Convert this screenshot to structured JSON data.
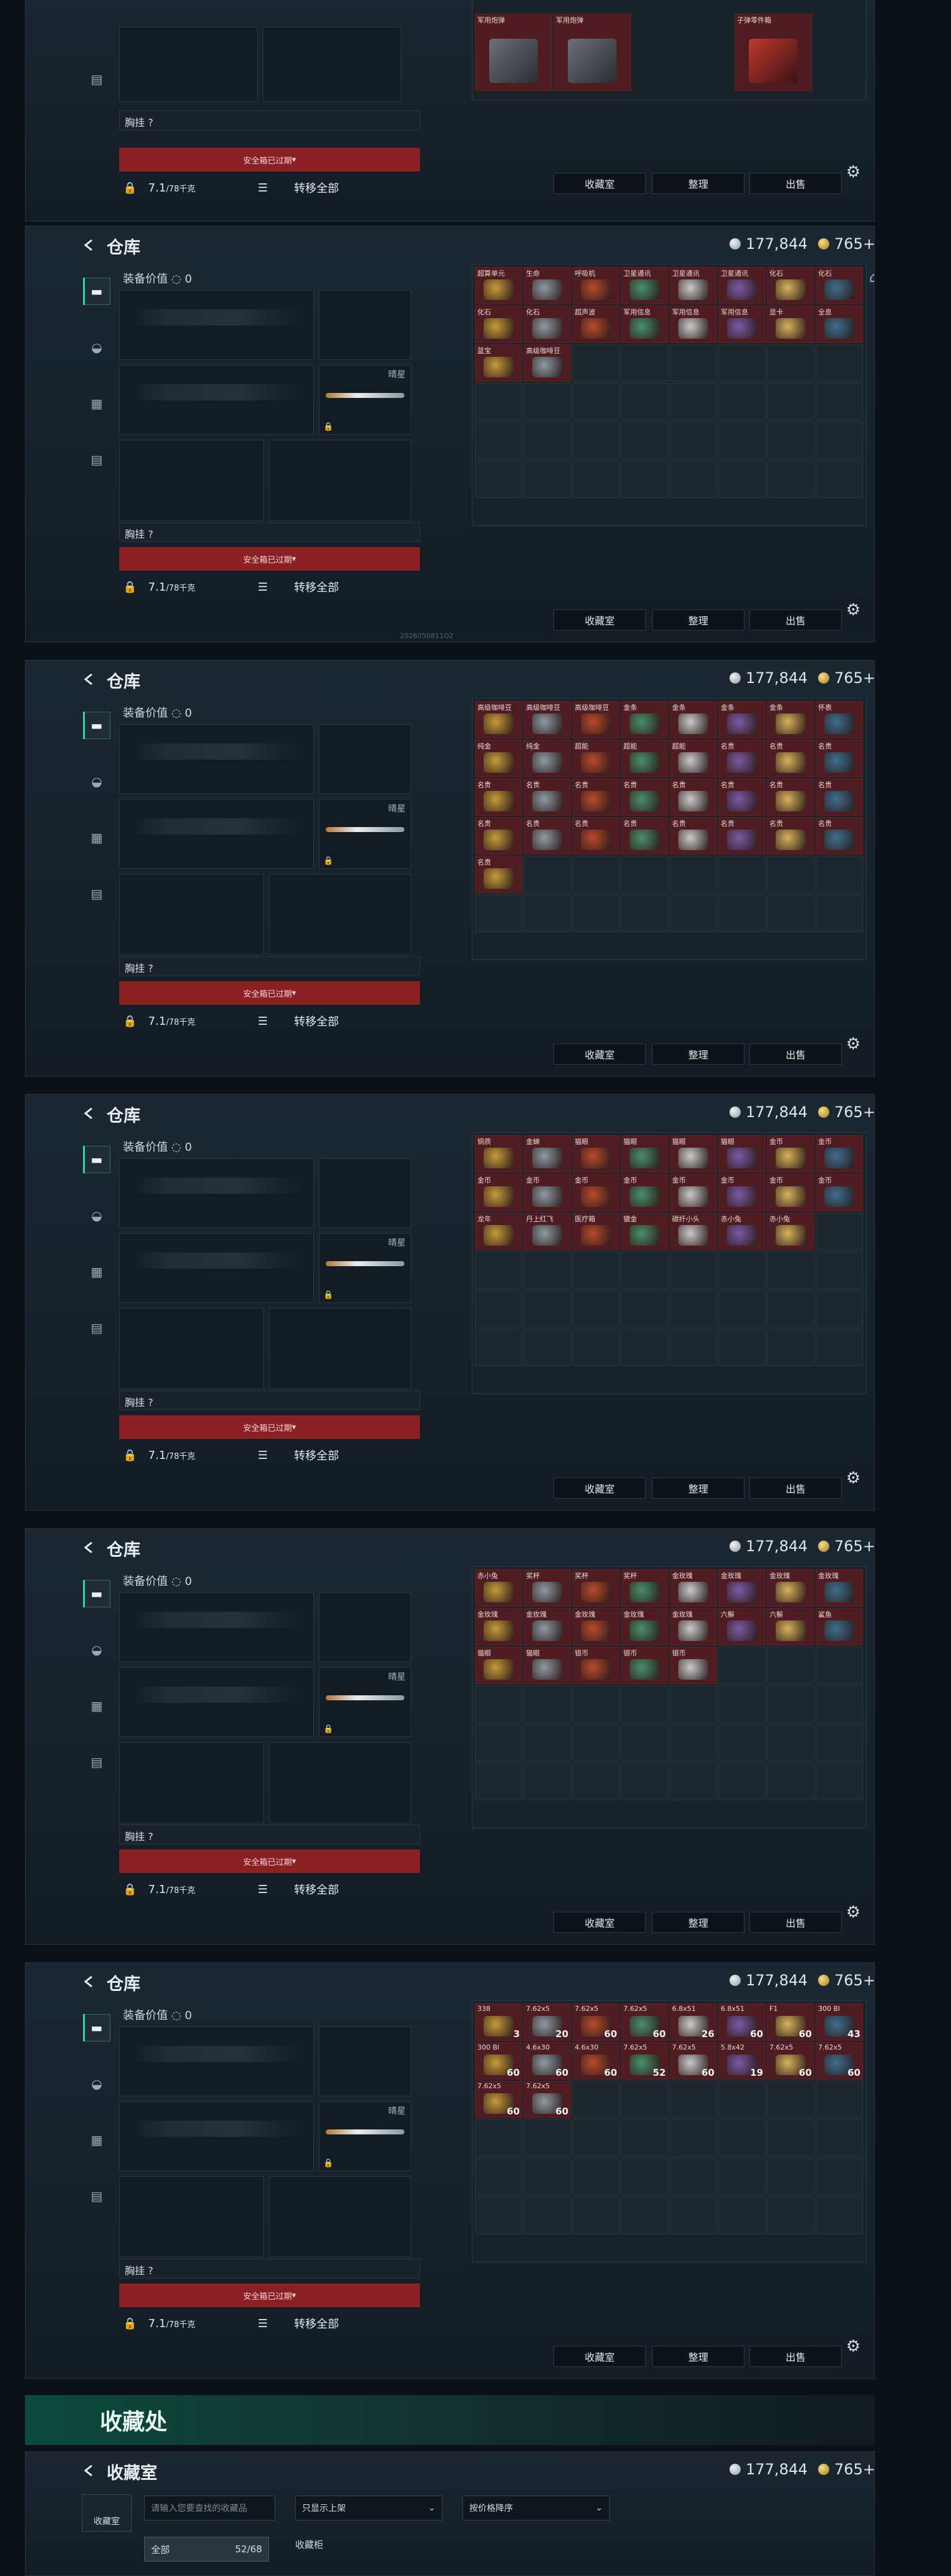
{
  "screens": [
    {
      "id": "s0",
      "title": "",
      "silver": "",
      "gold": ""
    },
    {
      "id": "s1",
      "title": "仓库",
      "silver": "177,844",
      "gold": "765+"
    },
    {
      "id": "s2",
      "title": "仓库",
      "silver": "177,844",
      "gold": "765+"
    },
    {
      "id": "s3",
      "title": "仓库",
      "silver": "177,844",
      "gold": "765+"
    },
    {
      "id": "s4",
      "title": "仓库",
      "silver": "177,844",
      "gold": "765+"
    },
    {
      "id": "s5",
      "title": "仓库",
      "silver": "177,844",
      "gold": "765+"
    }
  ],
  "equip": {
    "value_label": "装备价值",
    "value": "0",
    "melee_label": "晴星",
    "chest_label": "胸挂 ?",
    "safe_label": "安全箱已过期",
    "capacity": "7.1",
    "capacity_unit": "/78千克",
    "transfer_all": "转移全部"
  },
  "buttons": {
    "collection": "收藏室",
    "sort": "整理",
    "sell": "出售"
  },
  "stamp": "2026050811O2",
  "grid0": [
    "军用炮弹",
    "军用炮弹",
    "子弹零件箱"
  ],
  "grid1": [
    "超算单元",
    "生命",
    "呼吸机",
    "卫星通讯",
    "卫星通讯",
    "卫星通讯",
    "化石",
    "化石",
    "化石",
    "化石",
    "超声波",
    "军用信息",
    "军用信息",
    "军用信息",
    "显卡",
    "全息",
    "蓝宝",
    "高级咖啡豆"
  ],
  "grid2": [
    "高级咖啡豆",
    "高级咖啡豆",
    "高级咖啡豆",
    "金条",
    "金条",
    "金条",
    "金条",
    "怀表",
    "纯金",
    "纯金",
    "超能",
    "超能",
    "超能",
    "名贵",
    "名贵",
    "名贵",
    "名贵",
    "名贵",
    "名贵",
    "名贵",
    "名贵",
    "名贵",
    "名贵",
    "名贵",
    "名贵",
    "名贵",
    "名贵",
    "名贵",
    "名贵",
    "名贵",
    "名贵",
    "名贵",
    "名贵"
  ],
  "grid3": [
    "铜质",
    "金蝉",
    "猫眼",
    "猫眼",
    "猫眼",
    "猫眼",
    "金币",
    "金币",
    "金币",
    "金币",
    "金币",
    "金币",
    "金币",
    "金币",
    "金币",
    "金币",
    "龙年",
    "丹上红飞",
    "医疗箱",
    "镀金",
    "碳纤小头",
    "赤小兔",
    "赤小兔"
  ],
  "grid4": [
    "赤小兔",
    "奖杯",
    "奖杯",
    "奖杯",
    "金玫瑰",
    "金玫瑰",
    "金玫瑰",
    "金玫瑰",
    "金玫瑰",
    "金玫瑰",
    "金玫瑰",
    "金玫瑰",
    "金玫瑰",
    "六鬃",
    "六鬃",
    "鲨鱼",
    "猫眼",
    "猫眼",
    "银币",
    "银币",
    "银币"
  ],
  "grid5": [
    "338",
    "7.62x5",
    "7.62x5",
    "7.62x5",
    "6.8x51",
    "6.8x51",
    "F1",
    "300 Bl",
    "300 Bl",
    "4.6x30",
    "4.6x30",
    "7.62x5",
    "7.62x5",
    "5.8x42",
    "7.62x5",
    "7.62x5",
    "7.62x5",
    "7.62x5"
  ],
  "grid5_qty": [
    "3",
    "20",
    "60",
    "60",
    "26",
    "60",
    "60",
    "43",
    "60",
    "60",
    "60",
    "52",
    "60",
    "19",
    "60",
    "60",
    "60",
    "60"
  ],
  "collection": {
    "banner": "收藏处",
    "title": "收藏室",
    "silver": "177,844",
    "gold": "765+",
    "tab": "收藏室",
    "search_placeholder": "请输入您要查找的收藏品",
    "filter": "只显示上架",
    "order": "按价格降序",
    "all_label": "全部",
    "all_count": "52/68",
    "cabinet": "收藏柜"
  }
}
